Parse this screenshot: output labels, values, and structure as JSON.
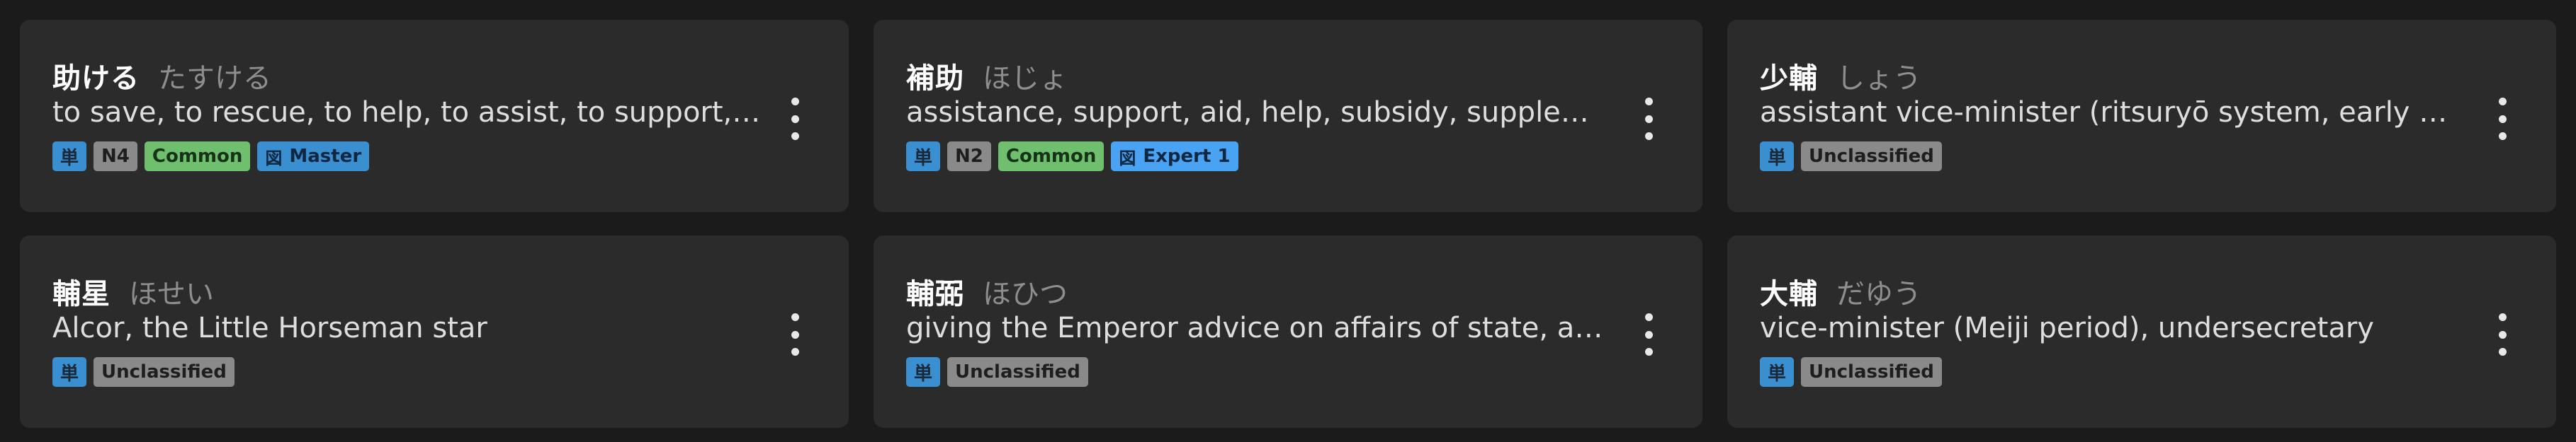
{
  "cards": [
    {
      "word": "助ける",
      "reading": "たすける",
      "meaning": "to save, to rescue, to help, to assist, to support, to aid",
      "tags": [
        {
          "label": "単",
          "kind": "single"
        },
        {
          "label": "N4",
          "kind": "level"
        },
        {
          "label": "Common",
          "kind": "common"
        },
        {
          "icon": "図",
          "label": "Master",
          "kind": "wk-master"
        }
      ]
    },
    {
      "word": "補助",
      "reading": "ほじょ",
      "meaning": "assistance, support, aid, help, subsidy, supplement",
      "tags": [
        {
          "label": "単",
          "kind": "single"
        },
        {
          "label": "N2",
          "kind": "level"
        },
        {
          "label": "Common",
          "kind": "common"
        },
        {
          "icon": "図",
          "label": "Expert 1",
          "kind": "wk-expert"
        }
      ]
    },
    {
      "word": "少輔",
      "reading": "しょう",
      "meaning": "assistant vice-minister (ritsuryō system, early Meiji period)",
      "tags": [
        {
          "label": "単",
          "kind": "single"
        },
        {
          "label": "Unclassified",
          "kind": "uncl"
        }
      ]
    },
    {
      "word": "輔星",
      "reading": "ほせい",
      "meaning": "Alcor, the Little Horseman star",
      "tags": [
        {
          "label": "単",
          "kind": "single"
        },
        {
          "label": "Unclassified",
          "kind": "uncl"
        }
      ]
    },
    {
      "word": "輔弼",
      "reading": "ほひつ",
      "meaning": "giving the Emperor advice on affairs of state, assisting the Emperor",
      "tags": [
        {
          "label": "単",
          "kind": "single"
        },
        {
          "label": "Unclassified",
          "kind": "uncl"
        }
      ]
    },
    {
      "word": "大輔",
      "reading": "だゆう",
      "meaning": "vice-minister (Meiji period), undersecretary",
      "tags": [
        {
          "label": "単",
          "kind": "single"
        },
        {
          "label": "Unclassified",
          "kind": "uncl"
        }
      ]
    }
  ],
  "menu_icon": "more-vertical-icon"
}
